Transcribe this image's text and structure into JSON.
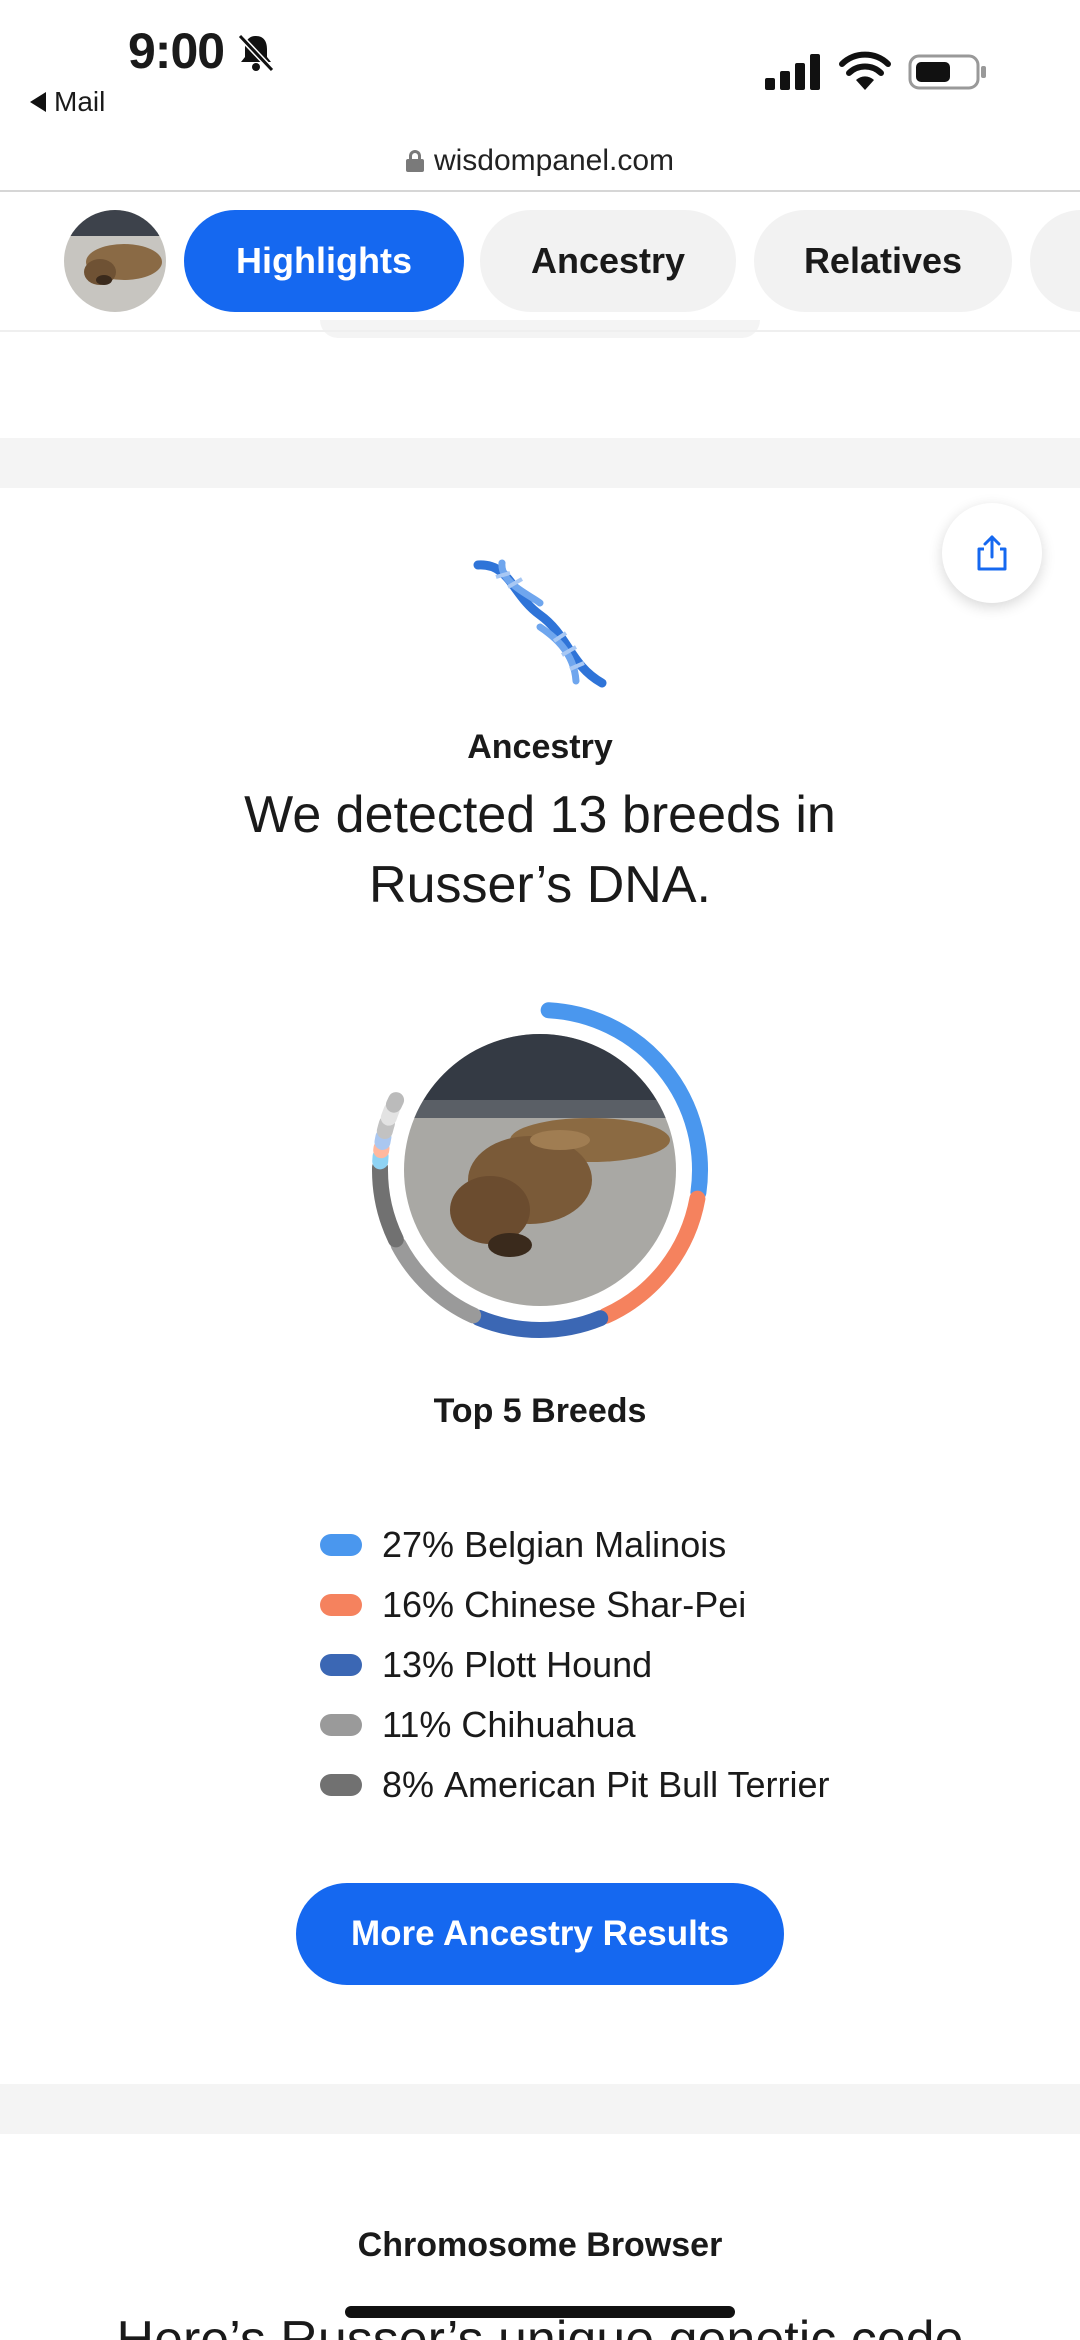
{
  "status_bar": {
    "time": "9:00",
    "back_label": "Mail"
  },
  "browser": {
    "url": "wisdompanel.com"
  },
  "tabs": [
    {
      "label": "Highlights",
      "active": true
    },
    {
      "label": "Ancestry",
      "active": false
    },
    {
      "label": "Relatives",
      "active": false
    }
  ],
  "ancestry": {
    "section_label": "Ancestry",
    "headline": "We detected 13 breeds in Russer’s DNA.",
    "top_label": "Top 5 Breeds",
    "cta_label": "More Ancestry Results",
    "breeds": [
      {
        "percent": "27%",
        "name": "Belgian Malinois",
        "color": "#4a97ee"
      },
      {
        "percent": "16%",
        "name": "Chinese Shar-Pei",
        "color": "#f5825e"
      },
      {
        "percent": "13%",
        "name": "Plott Hound",
        "color": "#3b67b4"
      },
      {
        "percent": "11%",
        "name": "Chihuahua",
        "color": "#9a9a9a"
      },
      {
        "percent": "8%",
        "name": "American Pit Bull Terrier",
        "color": "#717171"
      }
    ]
  },
  "chart_data": {
    "type": "pie",
    "title": "Top 5 Breeds",
    "categories": [
      "Belgian Malinois",
      "Chinese Shar-Pei",
      "Plott Hound",
      "Chihuahua",
      "American Pit Bull Terrier"
    ],
    "values": [
      27,
      16,
      13,
      11,
      8
    ],
    "colors": [
      "#4a97ee",
      "#f5825e",
      "#3b67b4",
      "#9a9a9a",
      "#717171"
    ]
  },
  "chromosome": {
    "section_label": "Chromosome Browser",
    "headline": "Here’s Russer’s unique genetic code"
  }
}
